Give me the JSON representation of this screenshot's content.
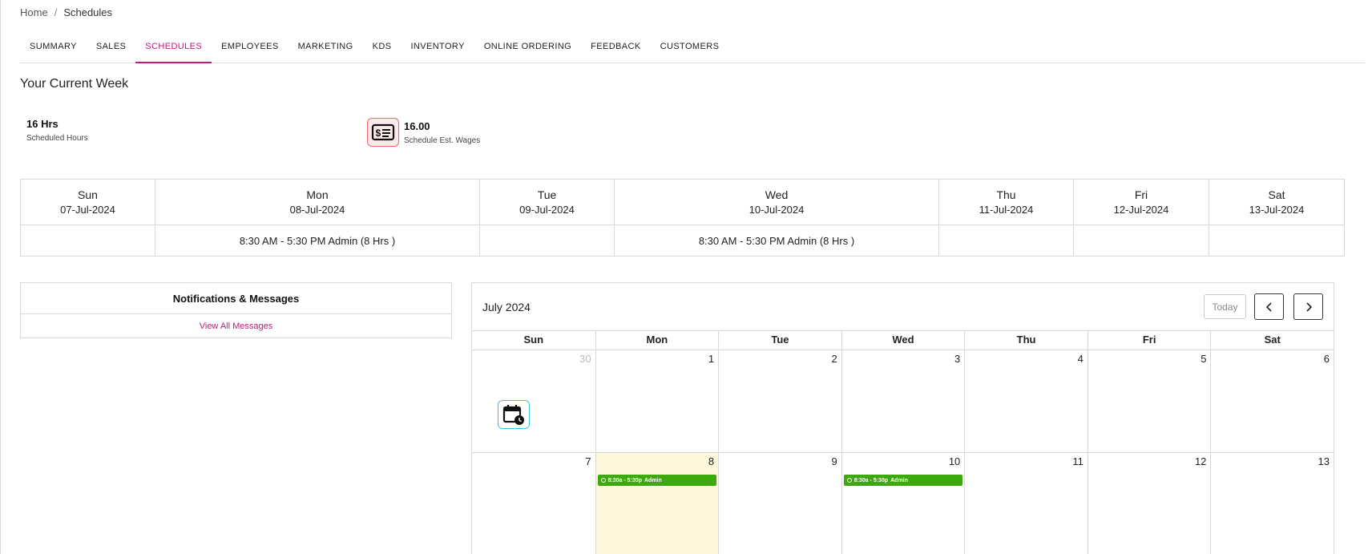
{
  "breadcrumb": {
    "home": "Home",
    "separator": "/",
    "current": "Schedules"
  },
  "tabs": [
    {
      "label": "SUMMARY"
    },
    {
      "label": "SALES"
    },
    {
      "label": "SCHEDULES",
      "active": true
    },
    {
      "label": "EMPLOYEES"
    },
    {
      "label": "MARKETING"
    },
    {
      "label": "KDS"
    },
    {
      "label": "INVENTORY"
    },
    {
      "label": "ONLINE ORDERING"
    },
    {
      "label": "FEEDBACK"
    },
    {
      "label": "CUSTOMERS"
    }
  ],
  "current_week": {
    "title": "Your Current Week",
    "stats": {
      "hours": {
        "value": "16 Hrs",
        "label": "Scheduled Hours",
        "icon": "calendar-clock-icon"
      },
      "wages": {
        "value": "16.00",
        "label": "Schedule Est. Wages",
        "icon": "dollar-bill-icon"
      }
    },
    "days": [
      {
        "day": "Sun",
        "date": "07-Jul-2024",
        "shift": ""
      },
      {
        "day": "Mon",
        "date": "08-Jul-2024",
        "shift": "8:30 AM - 5:30 PM Admin (8 Hrs )"
      },
      {
        "day": "Tue",
        "date": "09-Jul-2024",
        "shift": ""
      },
      {
        "day": "Wed",
        "date": "10-Jul-2024",
        "shift": "8:30 AM - 5:30 PM Admin (8 Hrs )"
      },
      {
        "day": "Thu",
        "date": "11-Jul-2024",
        "shift": ""
      },
      {
        "day": "Fri",
        "date": "12-Jul-2024",
        "shift": ""
      },
      {
        "day": "Sat",
        "date": "13-Jul-2024",
        "shift": ""
      }
    ]
  },
  "notifications": {
    "title": "Notifications & Messages",
    "view_all": "View All Messages"
  },
  "calendar": {
    "month": "July 2024",
    "today_label": "Today",
    "weekdays": [
      "Sun",
      "Mon",
      "Tue",
      "Wed",
      "Thu",
      "Fri",
      "Sat"
    ],
    "weeks": [
      [
        {
          "n": "30",
          "other": true
        },
        {
          "n": "1"
        },
        {
          "n": "2"
        },
        {
          "n": "3"
        },
        {
          "n": "4"
        },
        {
          "n": "5"
        },
        {
          "n": "6"
        }
      ],
      [
        {
          "n": "7"
        },
        {
          "n": "8",
          "today": true,
          "event": {
            "time": "8:30a - 5:30p",
            "who": "Admin"
          }
        },
        {
          "n": "9"
        },
        {
          "n": "10",
          "event": {
            "time": "8:30a - 5:30p",
            "who": "Admin"
          }
        },
        {
          "n": "11"
        },
        {
          "n": "12"
        },
        {
          "n": "13"
        }
      ]
    ]
  },
  "colors": {
    "accent": "#c2187f",
    "event": "#3ea80f",
    "today_bg": "#fef8db",
    "calendar_icon_border": "#3fc4e6",
    "wage_icon_border": "#ef6a6a"
  }
}
